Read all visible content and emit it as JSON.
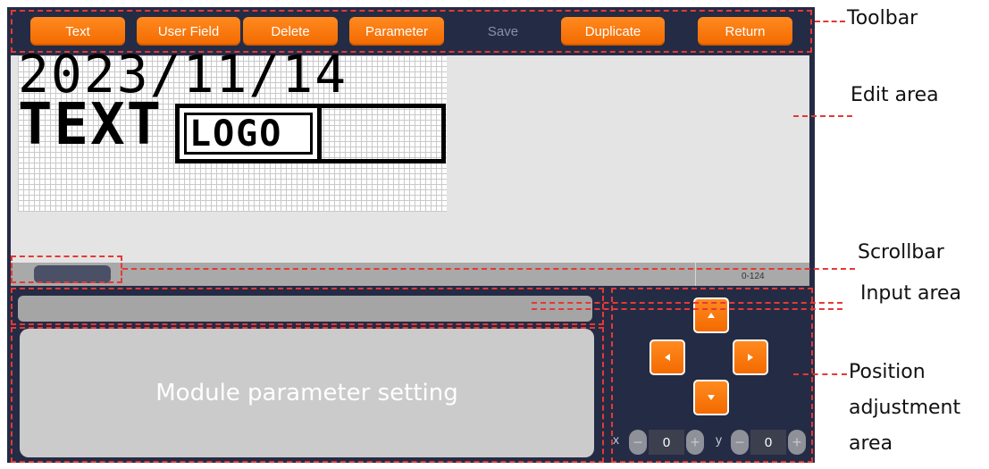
{
  "toolbar": {
    "buttons": [
      {
        "label": "Text"
      },
      {
        "label": "User Field"
      },
      {
        "label": "Delete"
      },
      {
        "label": "Parameter"
      },
      {
        "label": "Save"
      },
      {
        "label": "Duplicate"
      },
      {
        "label": "Return"
      }
    ]
  },
  "edit_area": {
    "date_text": "2023/11/14",
    "text_label": "TEXT",
    "logo_text": "LOGO"
  },
  "scrollbar": {
    "range_label": "0-124"
  },
  "module_area": {
    "placeholder": "Module parameter setting"
  },
  "position": {
    "x_label": "x",
    "x_value": "0",
    "y_label": "y",
    "y_value": "0",
    "minus": "−",
    "plus": "+"
  },
  "annotations": {
    "toolbar": "Toolbar",
    "edit_area": "Edit area",
    "scrollbar": "Scrollbar",
    "input_area": "Input area",
    "position_line1": "Position",
    "position_line2": "adjustment",
    "position_line3": "area"
  },
  "colors": {
    "screen_bg": "#242b45",
    "accent_orange": "#f57c00",
    "annotation_red": "#e53935"
  }
}
